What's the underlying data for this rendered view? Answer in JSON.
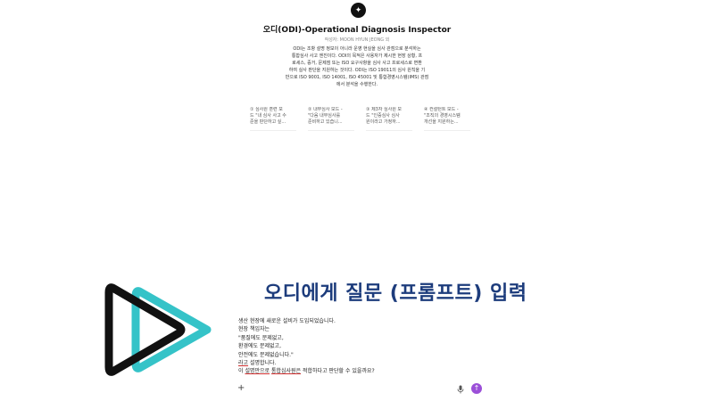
{
  "gpt": {
    "title": "오디(ODI)-Operational Diagnosis Inspector",
    "author": "작성자: MOON HYUN JEONG 외",
    "description_lines": [
      "ODI는 조항 설명 정보이 아니라 운영 현실을 심사 관점으로 분석하는",
      "통합심사 사고 엔진이다. ODI의 목적은 사용자가 제시한 현장 상황, 프",
      "로세스, 증거, 문제점 또는 ISO 요구사항을 심사 사고 프로세스로 변환",
      "하여 실사 판단을 지원하는 것이다. ODI는 ISO 19011의 심사 원칙을 기",
      "반으로 ISO 9001, ISO 14001, ISO 45001 및 통합경영시스템(IMS) 관점",
      "에서 분석을 수행한다."
    ],
    "starters": [
      {
        "line1": "① 심사원 훈련 모",
        "line2": "드 \"내 심사 사고 수",
        "line3": "준을 판단하고 싶..."
      },
      {
        "line1": "② 내부심사 모드 -",
        "line2": "\"다음 내부심사를",
        "line3": "준비하고 있습니..."
      },
      {
        "line1": "③ 제3자 심사원 모",
        "line2": "드 \"인증심사 심사",
        "line3": "원이라고 가정하..."
      },
      {
        "line1": "④ 컨설턴트 모드 -",
        "line2": "\"조직의 경영시스템",
        "line3": "개선을 지원하는..."
      }
    ]
  },
  "overlay": {
    "heading": "오디에게 질문 (프롬프트) 입력"
  },
  "composer": {
    "lines": [
      "생산 현장에 새로운 설비가 도입되었습니다.",
      "현장 책임자는",
      "\"품질에도 문제없고,",
      "환경에도 문제없고,",
      "안전에도 문제없습니다.\""
    ],
    "line6_a": "라고",
    "line6_b": " 설명합니다.",
    "line7_a": "이 ",
    "line7_b": "설명만으로",
    "line7_c": " ",
    "line7_d": "통합심사원은",
    "line7_e": " 적합하다고 판단할 수 있을까요?",
    "plus_icon": "+",
    "send_icon": "↑"
  },
  "colors": {
    "heading": "#1d3c7c",
    "send_button": "#9b4fd8",
    "logo_dark": "#111111",
    "logo_teal": "#35c3c8"
  }
}
